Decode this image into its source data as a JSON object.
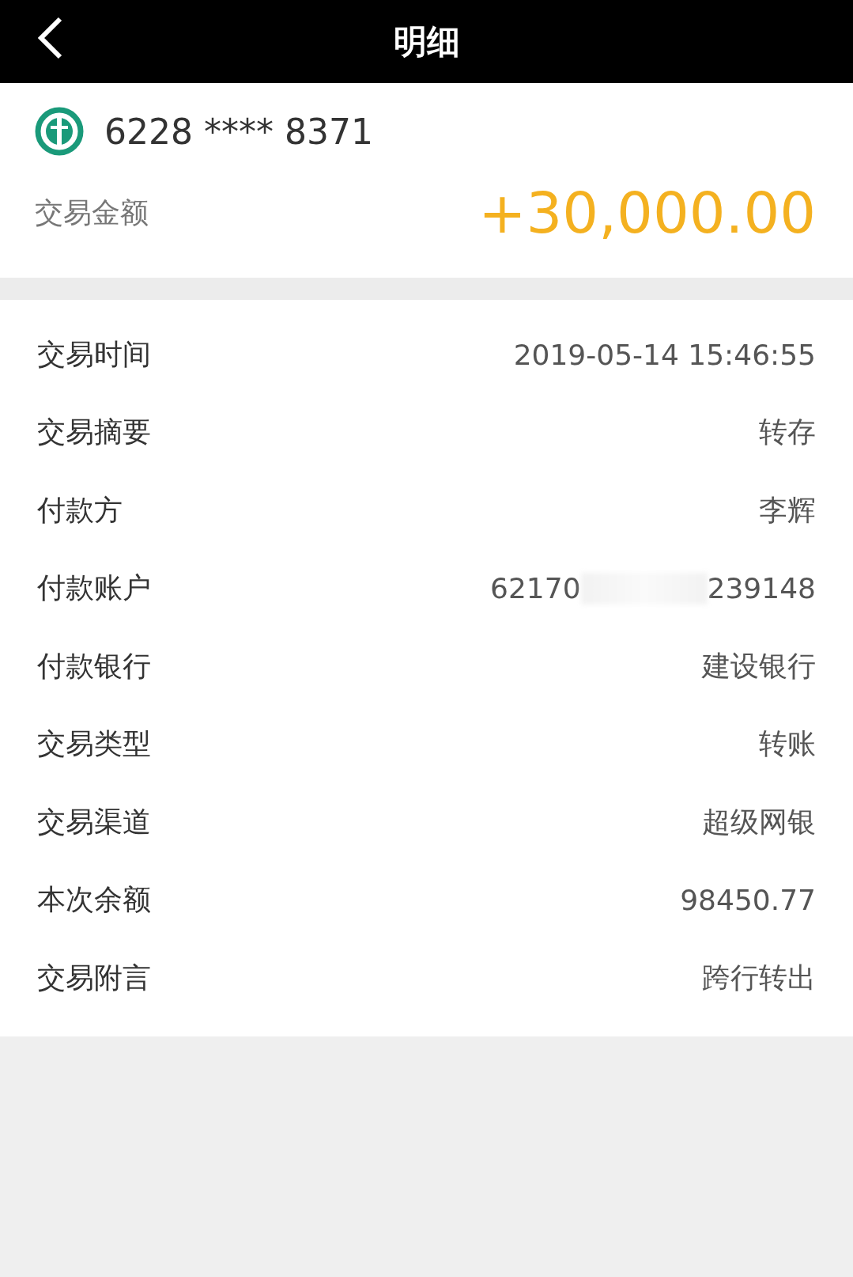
{
  "header": {
    "title": "明细"
  },
  "account": {
    "card_number": "6228 **** 8371",
    "amount_label": "交易金额",
    "amount": "+30,000.00"
  },
  "rows": [
    {
      "kind": "text",
      "label": "交易时间",
      "value": "2019-05-14 15:46:55"
    },
    {
      "kind": "text",
      "label": "交易摘要",
      "value": "转存"
    },
    {
      "kind": "text",
      "label": "付款方",
      "value": "李辉"
    },
    {
      "kind": "masked",
      "label": "付款账户",
      "prefix": "62170",
      "suffix": "239148"
    },
    {
      "kind": "text",
      "label": "付款银行",
      "value": "建设银行"
    },
    {
      "kind": "text",
      "label": "交易类型",
      "value": "转账"
    },
    {
      "kind": "text",
      "label": "交易渠道",
      "value": "超级网银"
    },
    {
      "kind": "text",
      "label": "本次余额",
      "value": "98450.77"
    },
    {
      "kind": "text",
      "label": "交易附言",
      "value": "跨行转出"
    }
  ]
}
